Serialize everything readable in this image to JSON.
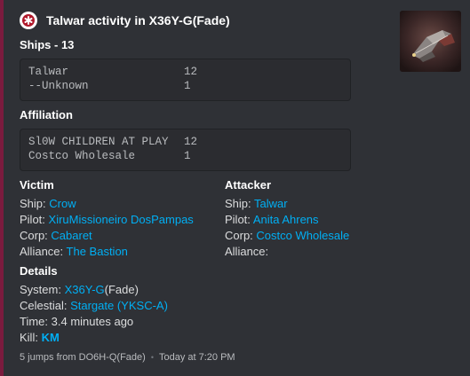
{
  "embed": {
    "accent_color": "#7b1b3e",
    "author": {
      "icon": "red-asterisk-icon",
      "title": "Talwar activity in X36Y-G(Fade)"
    },
    "thumbnail": "ship-render-thumbnail"
  },
  "ships": {
    "title": "Ships - 13",
    "rows": [
      {
        "name": "Talwar",
        "count": "12"
      },
      {
        "name": "--Unknown",
        "count": "1"
      }
    ]
  },
  "affiliation": {
    "title": "Affiliation",
    "rows": [
      {
        "name": "Sl0W CHILDREN AT PLAY",
        "count": "12"
      },
      {
        "name": "Costco Wholesale",
        "count": "1"
      }
    ]
  },
  "victim": {
    "title": "Victim",
    "ship_label": "Ship:",
    "ship": "Crow",
    "pilot_label": "Pilot:",
    "pilot": "XiruMissioneiro DosPampas",
    "corp_label": "Corp:",
    "corp": "Cabaret",
    "alliance_label": "Alliance:",
    "alliance": "The Bastion"
  },
  "attacker": {
    "title": "Attacker",
    "ship_label": "Ship:",
    "ship": "Talwar",
    "pilot_label": "Pilot:",
    "pilot": "Anita Ahrens",
    "corp_label": "Corp:",
    "corp": "Costco Wholesale",
    "alliance_label": "Alliance:",
    "alliance": ""
  },
  "details": {
    "title": "Details",
    "system_label": "System:",
    "system_link": "X36Y-G",
    "system_suffix": "(Fade)",
    "celestial_label": "Celestial:",
    "celestial": "Stargate (YKSC-A)",
    "time_label": "Time:",
    "time": "3.4 minutes ago",
    "kill_label": "Kill:",
    "kill": "KM"
  },
  "footer": {
    "text": "5 jumps from DO6H-Q(Fade)",
    "separator": "•",
    "timestamp": "Today at 7:20 PM"
  }
}
